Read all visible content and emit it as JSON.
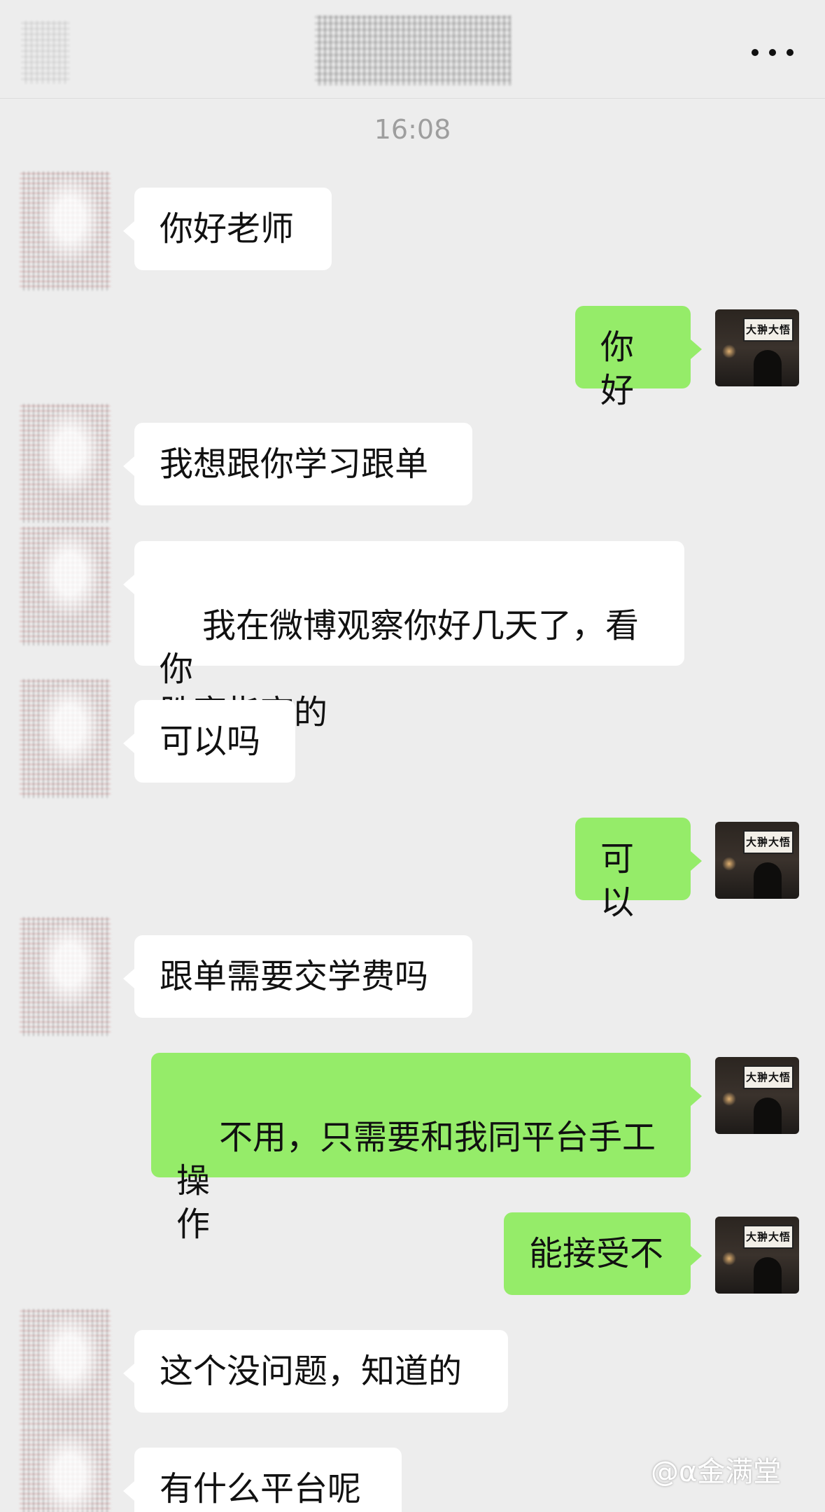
{
  "header": {
    "title": "",
    "more_icon": "more-dots-icon"
  },
  "timestamp": "16:08",
  "messages": [
    {
      "dir": "in",
      "text": "你好老师"
    },
    {
      "dir": "out",
      "text": "你好"
    },
    {
      "dir": "in",
      "text": "我想跟你学习跟单"
    },
    {
      "dir": "in",
      "text": "我在微博观察你好几天了，看你\n胜率指高的"
    },
    {
      "dir": "in",
      "text": "可以吗"
    },
    {
      "dir": "out",
      "text": "可以"
    },
    {
      "dir": "in",
      "text": "跟单需要交学费吗"
    },
    {
      "dir": "out",
      "text": "不用，只需要和我同平台手工操\n作"
    },
    {
      "dir": "out",
      "text": "能接受不"
    },
    {
      "dir": "in",
      "text": "这个没问题，知道的"
    },
    {
      "dir": "in",
      "text": "有什么平台呢"
    }
  ],
  "my_avatar_sign": "大翀大悟",
  "watermark": "@α金满堂",
  "colors": {
    "background": "#ededed",
    "incoming_bubble": "#ffffff",
    "outgoing_bubble": "#95ec69"
  }
}
